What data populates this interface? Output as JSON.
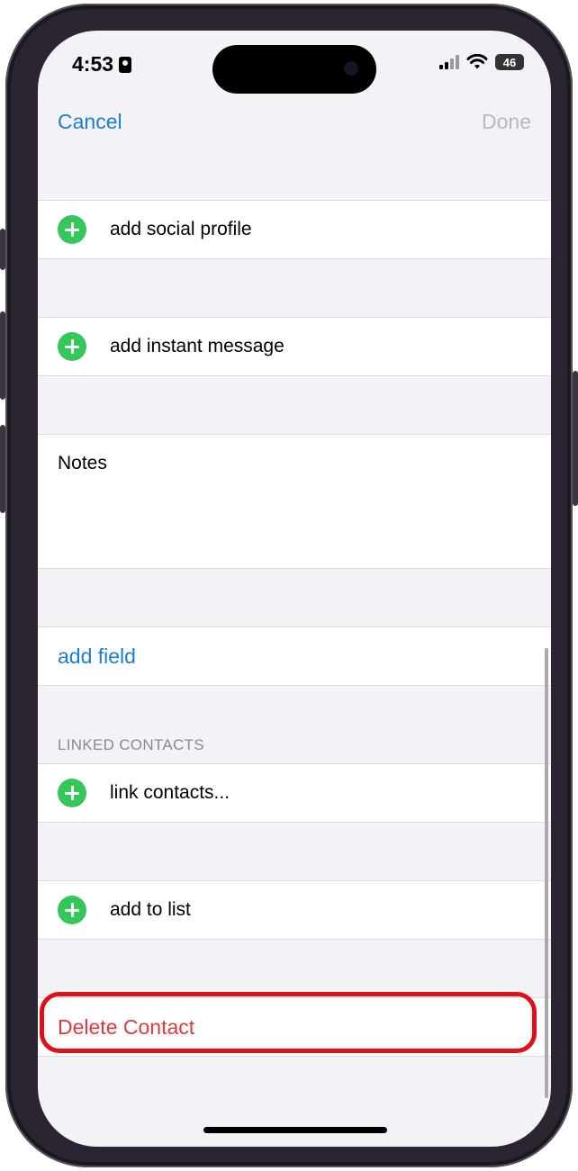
{
  "status_bar": {
    "time": "4:53",
    "battery": "46"
  },
  "nav": {
    "cancel_label": "Cancel",
    "done_label": "Done"
  },
  "rows": {
    "add_social_profile": "add social profile",
    "add_instant_message": "add instant message",
    "notes_label": "Notes",
    "add_field": "add field",
    "linked_contacts_header": "LINKED CONTACTS",
    "link_contacts": "link contacts...",
    "add_to_list": "add to list",
    "delete_contact": "Delete Contact"
  },
  "colors": {
    "accent_blue": "#1a7fd0",
    "add_green": "#34c759",
    "destructive_red": "#e0393e",
    "annotation_red": "#e0101a",
    "disabled_gray": "#b8b8bd",
    "group_background": "#f2f2f7"
  },
  "icons": {
    "add": "plus-circle-icon",
    "signal": "cellular-signal-icon",
    "wifi": "wifi-icon",
    "battery": "battery-icon",
    "focus": "id-card-icon"
  }
}
